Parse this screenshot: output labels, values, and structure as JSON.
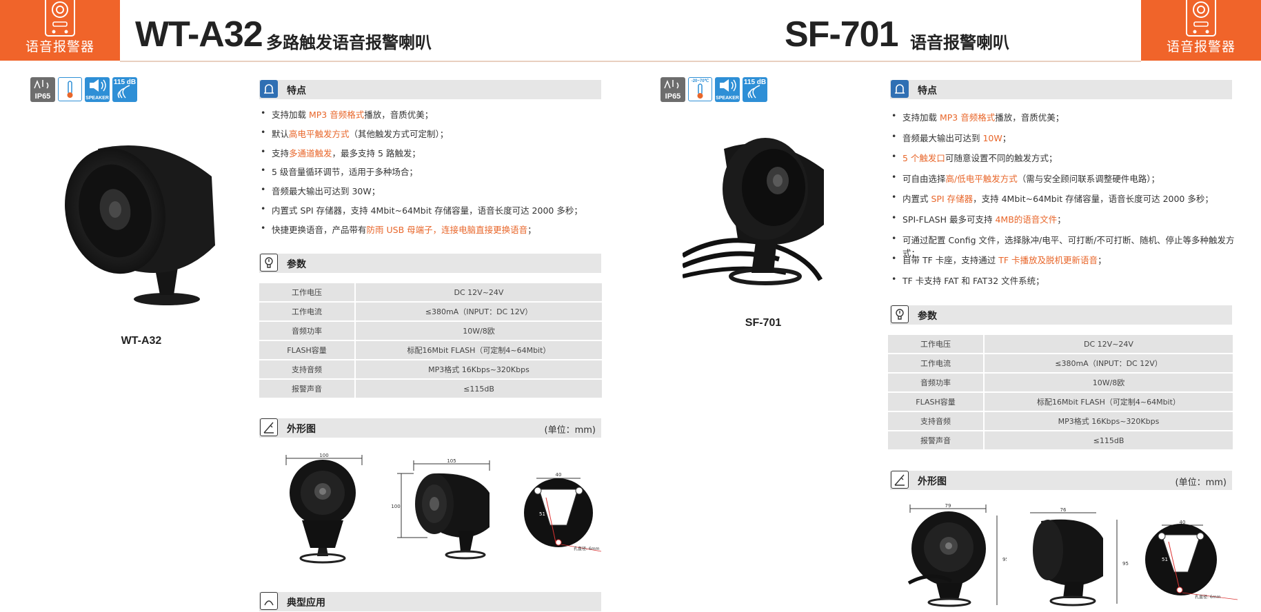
{
  "left": {
    "badge_label": "语音报警器",
    "model": "WT-A32",
    "subtitle": "多路触发语音报警喇叭",
    "icons": [
      {
        "name": "ip65-icon",
        "text": "IP65"
      },
      {
        "name": "temperature-icon",
        "text": ""
      },
      {
        "name": "speaker-icon",
        "text": "SPEAKER"
      },
      {
        "name": "decibel-icon",
        "text": "115 dB"
      }
    ],
    "product_caption": "WT-A32",
    "features_title": "特点",
    "features": [
      {
        "a": "支持加载 ",
        "b": "MP3 音频格式",
        "c": "播放，音质优美；"
      },
      {
        "a": " 默认",
        "b": "高电平触发方式",
        "c": "（其他触发方式可定制）；"
      },
      {
        "a": "支持",
        "b": "多通道触发",
        "c": "，最多支持 5 路触发；"
      },
      {
        "a": "5 级音量循环调节，适用于多种场合；",
        "b": "",
        "c": ""
      },
      {
        "a": "音频最大输出可达到 30W；",
        "b": "",
        "c": ""
      },
      {
        "a": "内置式 SPI 存储器，支持 4Mbit~64Mbit 存储容量，语音长度可达 2000 多秒；",
        "b": "",
        "c": ""
      },
      {
        "a": "快捷更换语音，产品带有",
        "b": "防雨 USB 母端子，连接电脑直接更换语音",
        "c": "；"
      }
    ],
    "params_title": "参数",
    "params": [
      {
        "k": "工作电压",
        "v": "DC 12V~24V"
      },
      {
        "k": "工作电流",
        "v": "≤380mA（INPUT：DC 12V）"
      },
      {
        "k": "音频功率",
        "v": "10W/8欧"
      },
      {
        "k": "FLASH容量",
        "v": "标配16Mbit FLASH（可定制4~64Mbit）"
      },
      {
        "k": "支持音频",
        "v": "MP3格式 16Kbps~320Kbps"
      },
      {
        "k": "报警声音",
        "v": "≤115dB"
      }
    ],
    "outline_title": "外形图",
    "outline_unit": "(单位：mm)",
    "dims": {
      "w1": "100",
      "w2": "105",
      "h2": "100",
      "w3": "40",
      "d3": "51",
      "hole": "孔直径: 6mm"
    },
    "app_title": "典型应用"
  },
  "right": {
    "badge_label": "语音报警器",
    "model": "SF-701",
    "subtitle": "语音报警喇叭",
    "icons": [
      {
        "name": "ip65-icon",
        "text": "IP65"
      },
      {
        "name": "temperature-range-icon",
        "text": "-20~70℃"
      },
      {
        "name": "speaker-icon",
        "text": "SPEAKER"
      },
      {
        "name": "decibel-icon",
        "text": "115 dB"
      }
    ],
    "product_caption": "SF-701",
    "features_title": "特点",
    "features": [
      {
        "a": "支持加载 ",
        "b": "MP3 音频格式",
        "c": "播放，音质优美；"
      },
      {
        "a": "音频最大输出可达到 ",
        "b": "10W",
        "c": "；"
      },
      {
        "a": "",
        "b": "5 个触发口",
        "c": "可随意设置不同的触发方式；"
      },
      {
        "a": "可自由选择",
        "b": "高/低电平触发方式",
        "c": "（需与安全顾问联系调整硬件电路）；"
      },
      {
        "a": "内置式 ",
        "b": "SPI 存储器",
        "c": "，支持 4Mbit~64Mbit 存储容量，语音长度可达 2000 多秒；"
      },
      {
        "a": "SPI-FLASH 最多可支持 ",
        "b": "4MB的语音文件",
        "c": "；"
      },
      {
        "a": "可通过配置 Config 文件，选择脉冲/电平、可打断/不可打断、随机、停止等多种触发方式；",
        "b": "",
        "c": ""
      },
      {
        "a": "自带 TF 卡座，支持通过 ",
        "b": "TF 卡播放及脱机更新语音",
        "c": "；"
      },
      {
        "a": "TF 卡支持 FAT 和 FAT32 文件系统；",
        "b": "",
        "c": ""
      }
    ],
    "params_title": "参数",
    "params": [
      {
        "k": "工作电压",
        "v": "DC 12V~24V"
      },
      {
        "k": "工作电流",
        "v": "≤380mA（INPUT：DC 12V）"
      },
      {
        "k": "音频功率",
        "v": "10W/8欧"
      },
      {
        "k": "FLASH容量",
        "v": "标配16Mbit FLASH（可定制4~64Mbit）"
      },
      {
        "k": "支持音频",
        "v": "MP3格式 16Kbps~320Kbps"
      },
      {
        "k": "报警声音",
        "v": "≤115dB"
      }
    ],
    "outline_title": "外形图",
    "outline_unit": "(单位：mm)",
    "dims": {
      "w1": "79",
      "h1": "95",
      "w2": "76",
      "h2": "95",
      "w3": "40",
      "d3": "51",
      "hole": "孔直径: 6mm"
    }
  },
  "colors": {
    "accent": "#f0642a",
    "highlight": "#e8662a",
    "bar": "#e6e6e6",
    "icon_blue": "#2e8fd6"
  }
}
